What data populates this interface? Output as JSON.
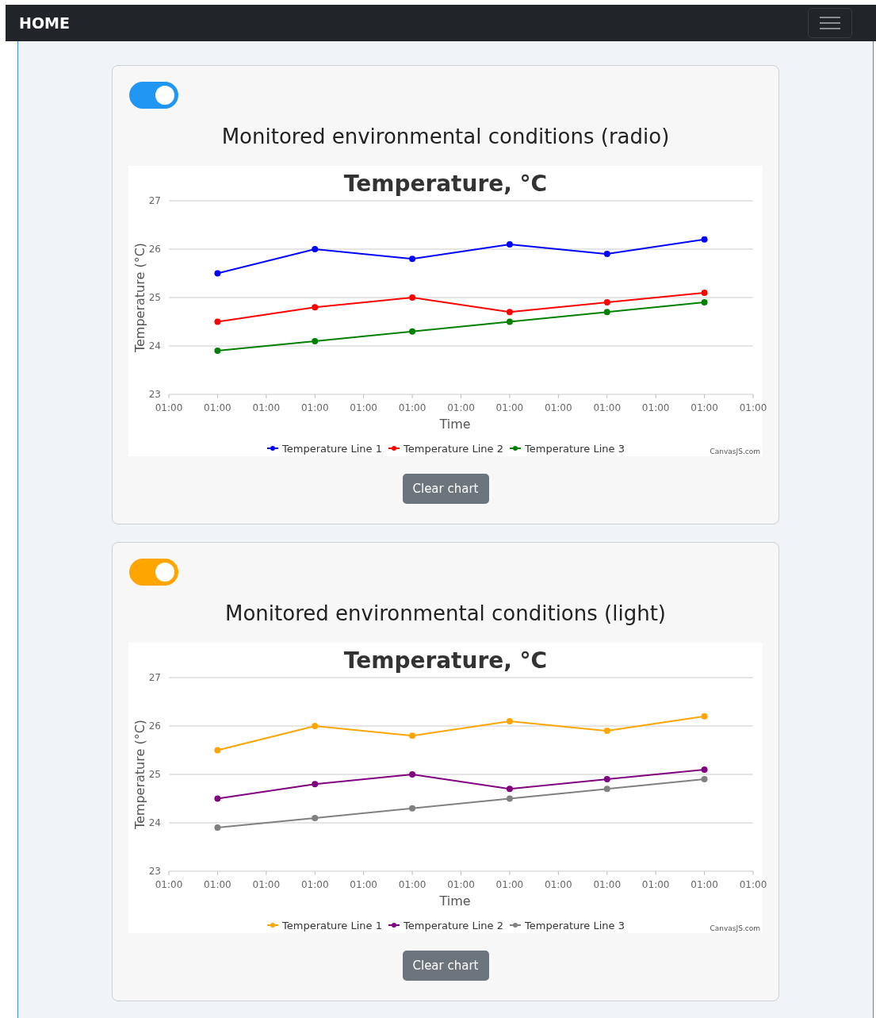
{
  "navbar": {
    "brand": "HOME"
  },
  "panels": [
    {
      "toggle": {
        "on": true,
        "color": "#2196f3"
      },
      "title": "Monitored environmental conditions (radio)",
      "chart_data": {
        "type": "line",
        "title": "Temperature, °C",
        "xlabel": "Time",
        "ylabel": "Temperature (°C)",
        "categories": [
          "01:00",
          "01:00",
          "01:00",
          "01:00",
          "01:00",
          "01:00",
          "01:00",
          "01:00",
          "01:00",
          "01:00",
          "01:00",
          "01:00",
          "01:00"
        ],
        "series": [
          {
            "name": "Temperature Line 1",
            "color": "#0000ff",
            "marker": "circle",
            "values": [
              null,
              25.5,
              null,
              26,
              null,
              25.8,
              null,
              26.1,
              null,
              25.9,
              null,
              26.2,
              null
            ]
          },
          {
            "name": "Temperature Line 2",
            "color": "#ff0000",
            "marker": "circle",
            "values": [
              null,
              24.5,
              null,
              24.8,
              null,
              25,
              null,
              24.7,
              null,
              24.9,
              null,
              25.1,
              null
            ]
          },
          {
            "name": "Temperature Line 3",
            "color": "#008000",
            "marker": "circle",
            "values": [
              null,
              23.9,
              null,
              24.1,
              null,
              24.3,
              null,
              24.5,
              null,
              24.7,
              null,
              24.9,
              null
            ]
          }
        ],
        "ylim": [
          23,
          27
        ],
        "yticks": [
          23,
          24,
          25,
          26,
          27
        ],
        "grid": true,
        "legend": "bottom"
      },
      "credit": "CanvasJS.com",
      "button": "Clear chart"
    },
    {
      "toggle": {
        "on": true,
        "color": "#ffa500"
      },
      "title": "Monitored environmental conditions (light)",
      "chart_data": {
        "type": "line",
        "title": "Temperature, °C",
        "xlabel": "Time",
        "ylabel": "Temperature (°C)",
        "categories": [
          "01:00",
          "01:00",
          "01:00",
          "01:00",
          "01:00",
          "01:00",
          "01:00",
          "01:00",
          "01:00",
          "01:00",
          "01:00",
          "01:00",
          "01:00"
        ],
        "series": [
          {
            "name": "Temperature Line 1",
            "color": "#ffa500",
            "marker": "circle",
            "values": [
              null,
              25.5,
              null,
              26,
              null,
              25.8,
              null,
              26.1,
              null,
              25.9,
              null,
              26.2,
              null
            ]
          },
          {
            "name": "Temperature Line 2",
            "color": "#800080",
            "marker": "circle",
            "values": [
              null,
              24.5,
              null,
              24.8,
              null,
              25,
              null,
              24.7,
              null,
              24.9,
              null,
              25.1,
              null
            ]
          },
          {
            "name": "Temperature Line 3",
            "color": "#808080",
            "marker": "circle",
            "values": [
              null,
              23.9,
              null,
              24.1,
              null,
              24.3,
              null,
              24.5,
              null,
              24.7,
              null,
              24.9,
              null
            ]
          }
        ],
        "ylim": [
          23,
          27
        ],
        "yticks": [
          23,
          24,
          25,
          26,
          27
        ],
        "grid": true,
        "legend": "bottom"
      },
      "credit": "CanvasJS.com",
      "button": "Clear chart"
    }
  ]
}
